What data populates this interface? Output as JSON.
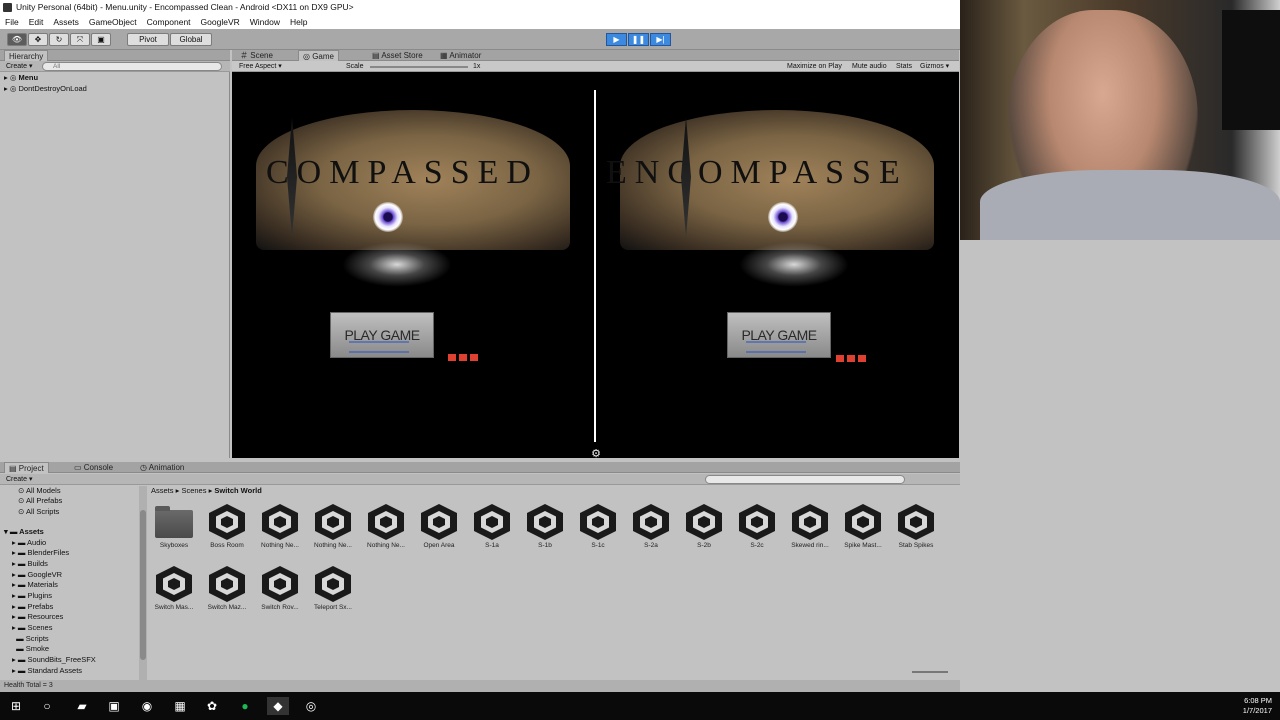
{
  "window": {
    "title": "Unity Personal (64bit) - Menu.unity - Encompassed Clean - Android <DX11 on DX9 GPU>"
  },
  "menu": [
    "File",
    "Edit",
    "Assets",
    "GameObject",
    "Component",
    "GoogleVR",
    "Window",
    "Help"
  ],
  "toolbar": {
    "pivot_label": "Pivot",
    "global_label": "Global",
    "play_icon": "play-icon",
    "pause_icon": "pause-icon",
    "step_icon": "step-icon"
  },
  "hierarchy": {
    "tab": "Hierarchy",
    "create_label": "Create",
    "search_placeholder": "All",
    "items": [
      {
        "label": "Menu"
      },
      {
        "label": "DontDestroyOnLoad"
      }
    ]
  },
  "view_tabs": [
    "Scene",
    "Game",
    "Asset Store",
    "Animator"
  ],
  "game_bar": {
    "aspect": "Free Aspect",
    "scale_label": "Scale",
    "scale_value": "1x",
    "maximize": "Maximize on Play",
    "mute": "Mute audio",
    "stats": "Stats",
    "gizmos": "Gizmos"
  },
  "game": {
    "title_text_left": "COMPASSED",
    "title_text_right": "ENCOMPASSE",
    "play_button_label": "PLAY GAME"
  },
  "project_tabs": [
    "Project",
    "Console",
    "Animation"
  ],
  "project": {
    "create_label": "Create",
    "favorites": [
      "All Models",
      "All Prefabs",
      "All Scripts"
    ],
    "assets_root": "Assets",
    "folders": [
      "Audio",
      "BlenderFiles",
      "Builds",
      "GoogleVR",
      "Materials",
      "Plugins",
      "Prefabs",
      "Resources",
      "Scenes",
      "Scripts",
      "Smoke",
      "SoundBits_FreeSFX",
      "Standard Assets"
    ],
    "breadcrumb": [
      "Assets",
      "Scenes",
      "Switch World"
    ],
    "assets": [
      {
        "label": "Skyboxes",
        "kind": "folder"
      },
      {
        "label": "Boss Room",
        "kind": "scene"
      },
      {
        "label": "Nothing Ne...",
        "kind": "scene"
      },
      {
        "label": "Nothing Ne...",
        "kind": "scene"
      },
      {
        "label": "Nothing Ne...",
        "kind": "scene"
      },
      {
        "label": "Open Area",
        "kind": "scene"
      },
      {
        "label": "S-1a",
        "kind": "scene"
      },
      {
        "label": "S-1b",
        "kind": "scene"
      },
      {
        "label": "S-1c",
        "kind": "scene"
      },
      {
        "label": "S-2a",
        "kind": "scene"
      },
      {
        "label": "S-2b",
        "kind": "scene"
      },
      {
        "label": "S-2c",
        "kind": "scene"
      },
      {
        "label": "Skewed rin...",
        "kind": "scene"
      },
      {
        "label": "Spike Mast...",
        "kind": "scene"
      },
      {
        "label": "Stab Spikes",
        "kind": "scene"
      },
      {
        "label": "Switch Mas...",
        "kind": "scene"
      },
      {
        "label": "Switch Maz...",
        "kind": "scene"
      },
      {
        "label": "Switch Rov...",
        "kind": "scene"
      },
      {
        "label": "Teleport Sx...",
        "kind": "scene"
      }
    ]
  },
  "status": {
    "text": "Health Total = 3"
  },
  "taskbar": {
    "time": "6:08 PM",
    "date": "1/7/2017"
  },
  "colors": {
    "play_active": "#3c8ae0",
    "editor_bg": "#c2c2c2",
    "dots": "#e04030"
  }
}
